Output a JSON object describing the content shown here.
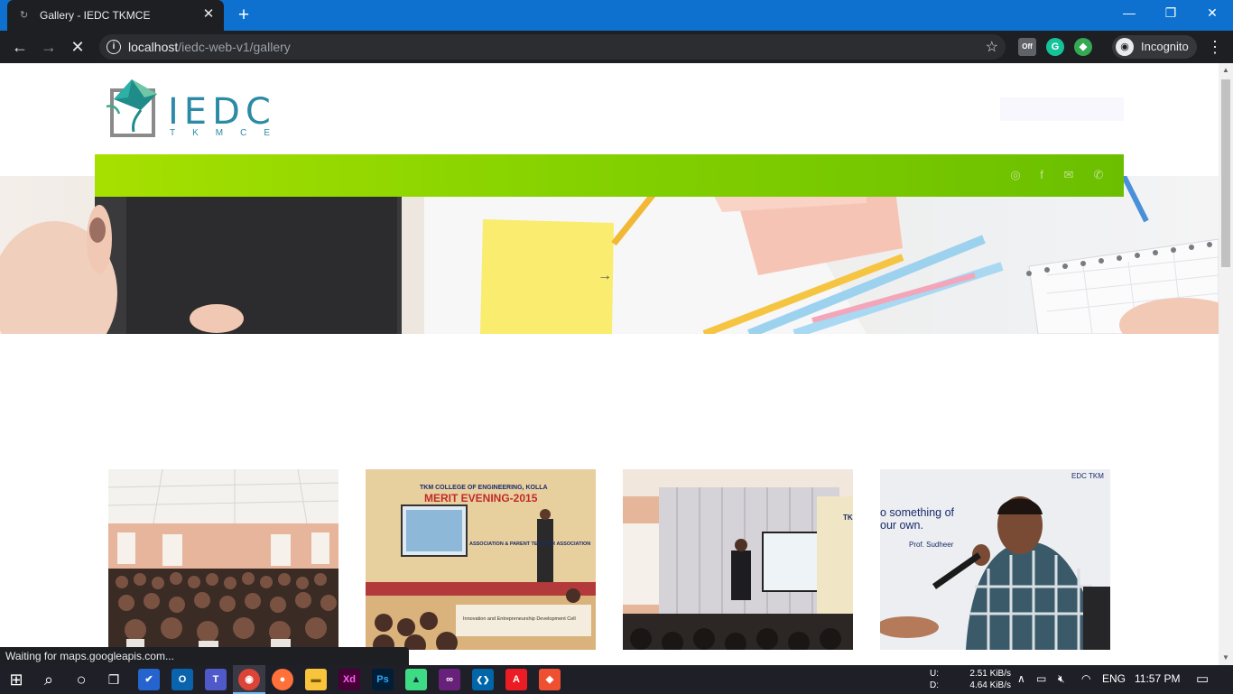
{
  "browser": {
    "tab_title": "Gallery - IEDC TKMCE",
    "tab_close": "✕",
    "new_tab": "+",
    "window_controls": {
      "minimize": "—",
      "restore": "❐",
      "close": "✕"
    },
    "nav": {
      "back": "←",
      "forward": "→",
      "stop": "✕"
    },
    "url_host": "localhost",
    "url_path": "/iedc-web-v1/gallery",
    "info_icon": "i",
    "star": "☆",
    "incognito_label": "Incognito",
    "incognito_icon": "◉",
    "extensions": [
      {
        "name": "off-extension",
        "text": "Off",
        "color": "#5f6368"
      },
      {
        "name": "grammarly",
        "text": "G",
        "color": "#15c39a"
      },
      {
        "name": "colorful-extension",
        "text": "◆",
        "color": "#34a853"
      }
    ],
    "menu": "⋮",
    "status_text": "Waiting for maps.googleapis.com..."
  },
  "site": {
    "logo": {
      "text": "IEDC",
      "subtext": "TKMCE"
    },
    "navbar_colors": [
      "#a6e000",
      "#6bbf00"
    ],
    "social_icons": [
      {
        "name": "instagram-icon",
        "glyph": "◎"
      },
      {
        "name": "facebook-icon",
        "glyph": "f"
      },
      {
        "name": "mail-icon",
        "glyph": "✉"
      },
      {
        "name": "phone-icon",
        "glyph": "✆"
      }
    ],
    "hero_arrow": "→",
    "gallery": [
      {
        "name": "gallery-photo-auditorium-crowd",
        "banner": ""
      },
      {
        "name": "gallery-photo-merit-evening",
        "banner": "TKM COLLEGE OF ENGINEERING, KOLLA",
        "banner2": "MERIT EVENING-2015",
        "banner3": "ASSOCIATION & PARENT TEACHER ASSOCIATION",
        "banner4": "Innovation and Entrepreneurship Development Cell"
      },
      {
        "name": "gallery-photo-speaker-stage",
        "banner": "TK"
      },
      {
        "name": "gallery-photo-prof-sudheer",
        "banner": "EDC TKM",
        "quote1": "o something of",
        "quote2": "our own.",
        "quote_author": "Prof. Sudheer"
      }
    ]
  },
  "taskbar": {
    "net_labels": [
      "U:",
      "D:"
    ],
    "net_values": [
      "2.51 KiB/s",
      "4.64 KiB/s"
    ],
    "tray_lang": "ENG",
    "clock": "11:57 PM",
    "apps": [
      {
        "name": "windows-start-icon",
        "glyph": "⊞",
        "color": "transparent"
      },
      {
        "name": "search-icon",
        "glyph": "⌕",
        "color": "transparent"
      },
      {
        "name": "cortana-icon",
        "glyph": "○",
        "color": "transparent"
      },
      {
        "name": "task-view-icon",
        "glyph": "❐",
        "color": "transparent"
      },
      {
        "name": "todo-icon",
        "glyph": "✔",
        "color": "#2564cf"
      },
      {
        "name": "outlook-icon",
        "glyph": "O",
        "color": "#0a64ad"
      },
      {
        "name": "teams-icon",
        "glyph": "T",
        "color": "#5059c9"
      },
      {
        "name": "chrome-icon",
        "glyph": "◉",
        "color": "#db4437"
      },
      {
        "name": "firefox-icon",
        "glyph": "●",
        "color": "#ff7139"
      },
      {
        "name": "file-explorer-icon",
        "glyph": "▬",
        "color": "#f8c43c"
      },
      {
        "name": "adobe-xd-icon",
        "glyph": "Xd",
        "color": "#470137"
      },
      {
        "name": "photoshop-icon",
        "glyph": "Ps",
        "color": "#001e36"
      },
      {
        "name": "android-studio-icon",
        "glyph": "▲",
        "color": "#3ddc84"
      },
      {
        "name": "visual-studio-icon",
        "glyph": "∞",
        "color": "#68217a"
      },
      {
        "name": "vscode-icon",
        "glyph": "❮❯",
        "color": "#0065a9"
      },
      {
        "name": "acrobat-icon",
        "glyph": "A",
        "color": "#ec1c24"
      },
      {
        "name": "git-icon",
        "glyph": "◆",
        "color": "#f05032"
      }
    ]
  }
}
